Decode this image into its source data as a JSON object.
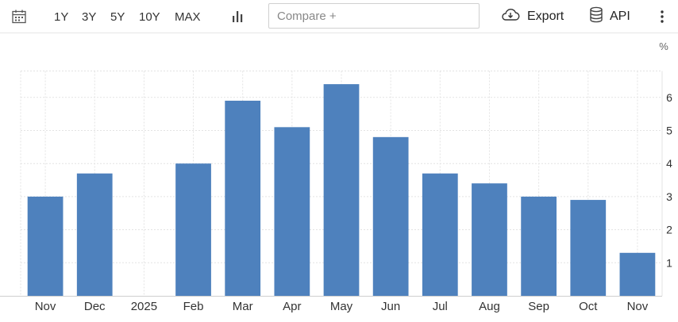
{
  "toolbar": {
    "calendar_icon": "calendar-icon",
    "ranges": [
      "1Y",
      "3Y",
      "5Y",
      "10Y",
      "MAX"
    ],
    "chart_type_icon": "bar-chart-icon",
    "compare_placeholder": "Compare +",
    "export_label": "Export",
    "export_icon": "cloud-download-icon",
    "api_label": "API",
    "api_icon": "database-icon",
    "more_icon": "vertical-dots-icon"
  },
  "chart_data": {
    "type": "bar",
    "categories": [
      "Nov",
      "Dec",
      "2025",
      "Feb",
      "Mar",
      "Apr",
      "May",
      "Jun",
      "Jul",
      "Aug",
      "Sep",
      "Oct",
      "Nov"
    ],
    "values": [
      3.0,
      3.7,
      0,
      4.0,
      5.9,
      5.1,
      6.4,
      4.8,
      3.7,
      3.4,
      3.0,
      2.9,
      1.3
    ],
    "ylabel": "%",
    "yticks": [
      1,
      2,
      3,
      4,
      5,
      6
    ],
    "ylim": [
      0,
      6.8
    ],
    "grid": true,
    "bar_color": "#4e81bd",
    "grid_color": "#e3e3e3"
  }
}
